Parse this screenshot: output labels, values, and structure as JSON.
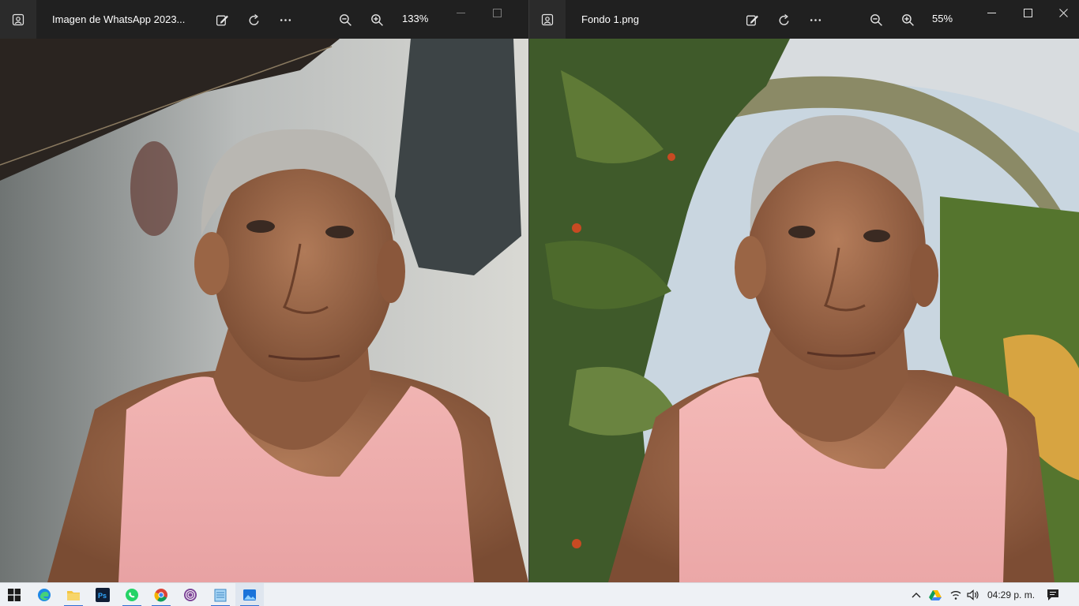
{
  "windows": [
    {
      "title": "Imagen de WhatsApp 2023...",
      "zoom": "133%",
      "toolbar_icons": [
        "image-icon",
        "edit-icon",
        "rotate-icon",
        "more-icon",
        "zoom-out-icon",
        "zoom-in-icon"
      ]
    },
    {
      "title": "Fondo 1.png",
      "zoom": "55%",
      "toolbar_icons": [
        "image-icon",
        "edit-icon",
        "rotate-icon",
        "more-icon",
        "zoom-out-icon",
        "zoom-in-icon"
      ]
    }
  ],
  "taskbar": {
    "apps": [
      "windows-start",
      "edge",
      "file-explorer",
      "photoshop",
      "whatsapp",
      "chrome",
      "tor-browser",
      "notepad",
      "photos"
    ],
    "tray": [
      "chevron-up",
      "google-drive",
      "wifi",
      "volume",
      "notification"
    ],
    "clock": "04:29 p. m."
  },
  "colors": {
    "titlebar": "#202020",
    "taskbar": "#eef1f5",
    "accent": "#2f6fd4"
  }
}
